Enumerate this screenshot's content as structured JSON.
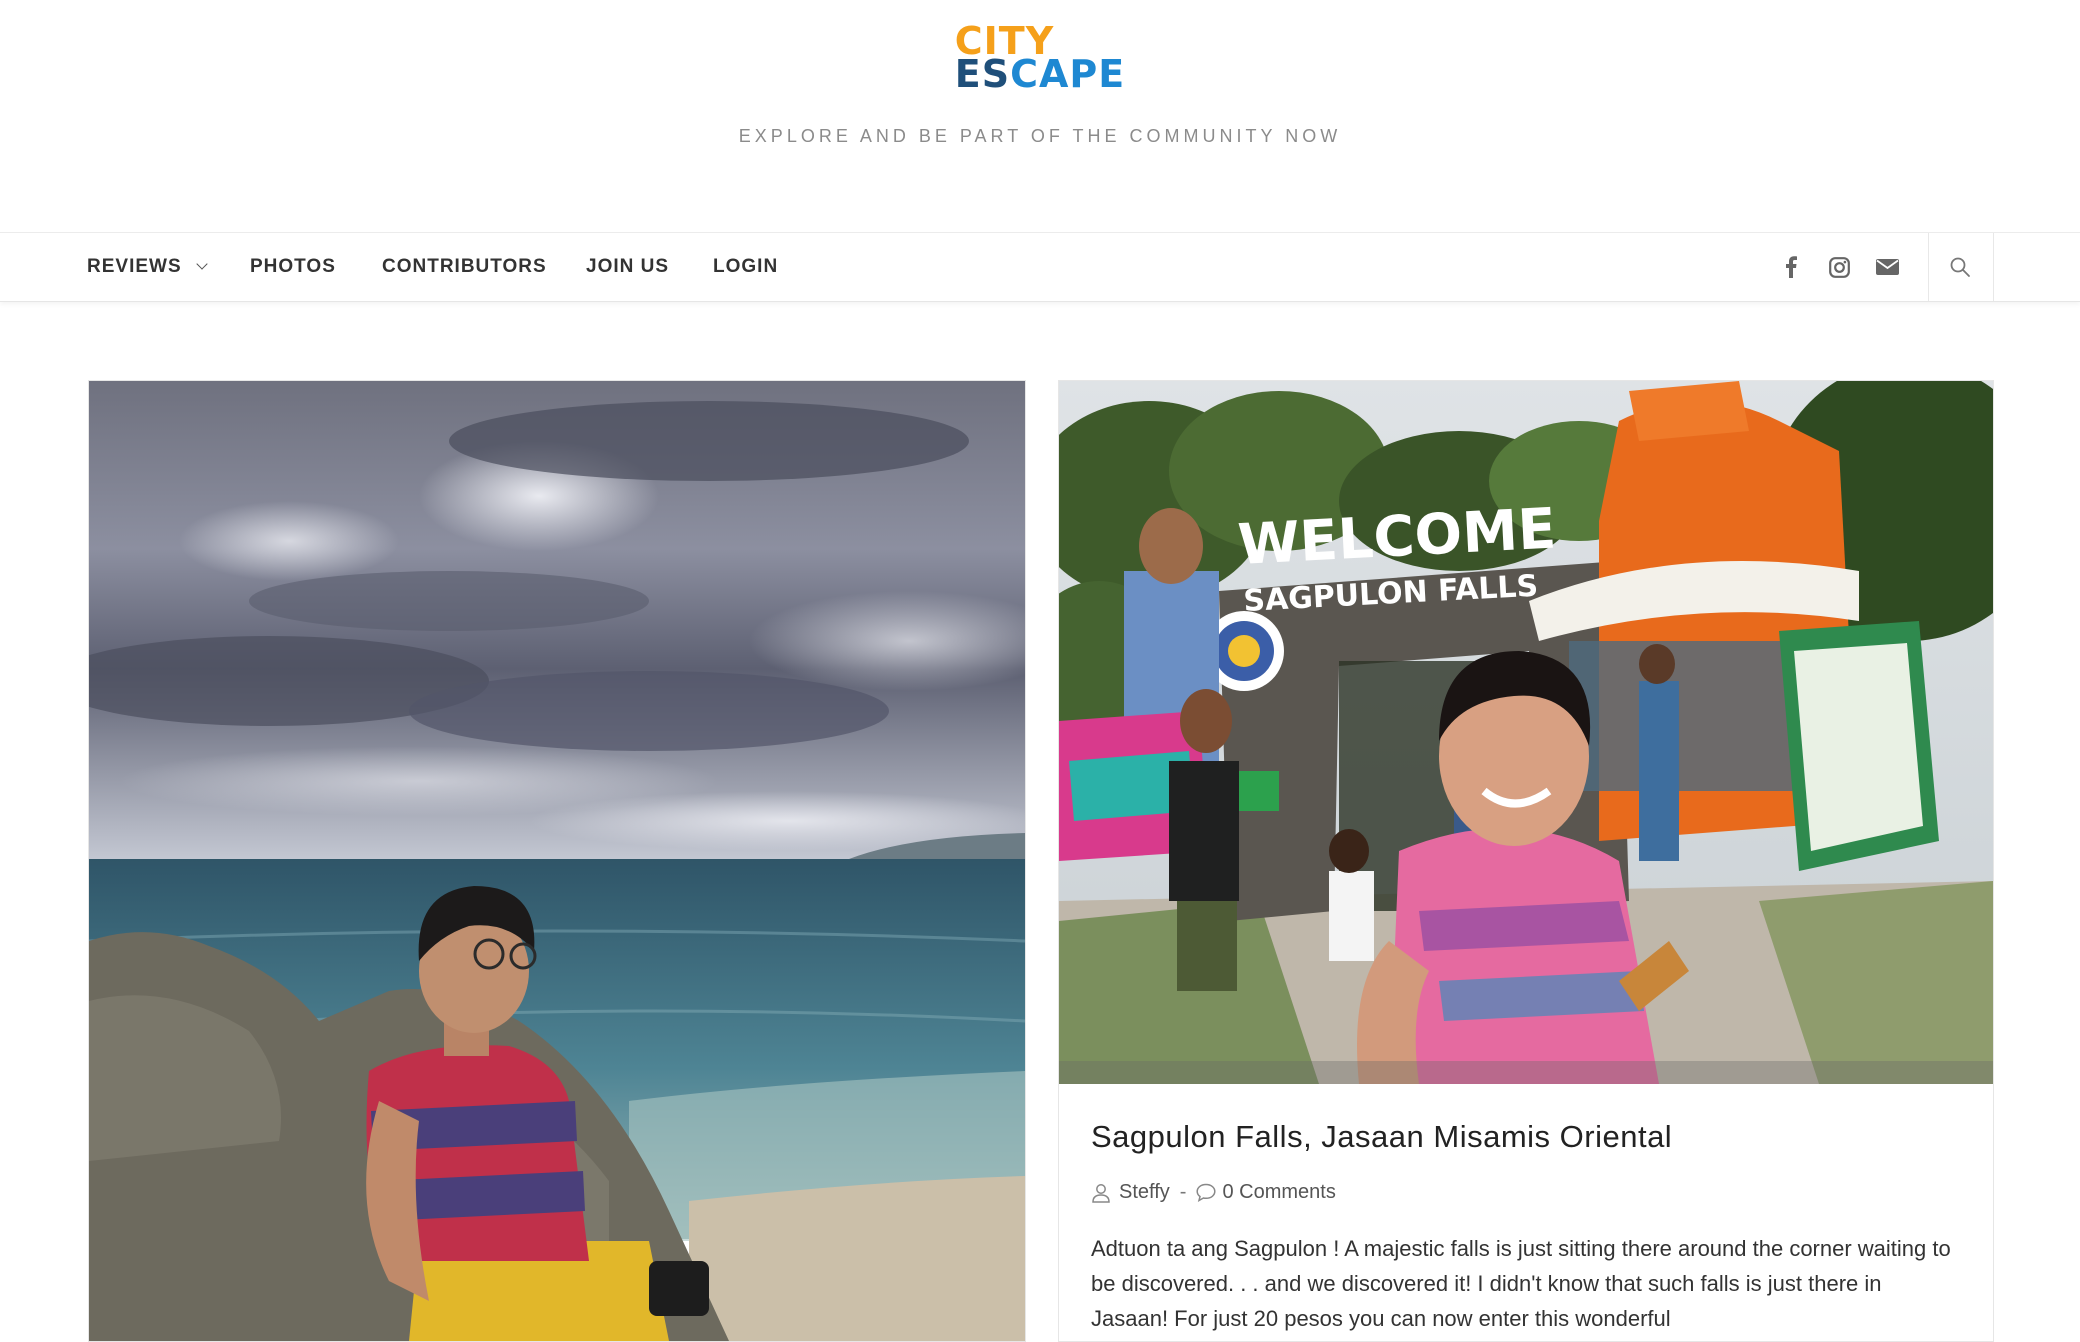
{
  "site": {
    "logo_top": "CITY",
    "logo_bottom_a": "ES",
    "logo_bottom_b": "CAPE",
    "tagline": "EXPLORE AND BE PART OF THE COMMUNITY NOW"
  },
  "nav": {
    "items": [
      {
        "label": "REVIEWS"
      },
      {
        "label": "PHOTOS"
      },
      {
        "label": "CONTRIBUTORS"
      },
      {
        "label": "JOIN US"
      },
      {
        "label": "LOGIN"
      }
    ],
    "social_icons": [
      "facebook-icon",
      "instagram-icon",
      "envelope-icon"
    ],
    "search_icon": "search-icon"
  },
  "posts": [
    {
      "image": "man in striped shirt sitting on rocks by the sea under cloudy sky"
    },
    {
      "image": "woman taking selfie at Welcome Sagpulon Falls gate",
      "image_text_1": "WELCOME",
      "image_text_2": "SAGPULON FALLS",
      "title": "Sagpulon Falls, Jasaan Misamis Oriental",
      "author": "Steffy",
      "separator": "-",
      "comments": "0 Comments",
      "excerpt": "Adtuon ta ang Sagpulon ! A majestic falls is just sitting there around the corner waiting to be discovered. . . and we discovered it! I didn't know that such falls is just there in Jasaan! For just 20 pesos you can now enter this wonderful"
    }
  ],
  "colors": {
    "logo_orange": "#f5a01a",
    "logo_navy": "#1f4f7a",
    "logo_blue": "#1e88d2"
  }
}
